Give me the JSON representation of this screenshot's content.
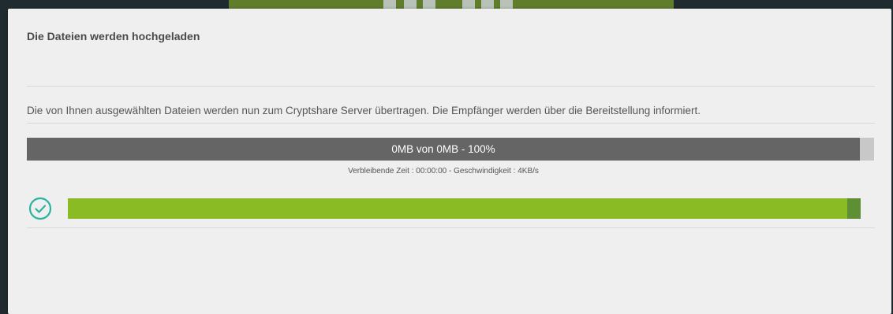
{
  "dialog": {
    "title": "Die Dateien werden hochgeladen",
    "info_text": "Die von Ihnen ausgewählten Dateien werden nun zum Cryptshare Server übertragen. Die Empfänger werden über die Bereitstellung informiert."
  },
  "total_progress": {
    "label": "0MB von  0MB - 100%",
    "percent": 100,
    "stats": "Verbleibende Zeit : 00:00:00 -  Geschwindigkeit : 4KB/s"
  },
  "file_progress": {
    "status_icon": "check-circle-icon",
    "percent": 100
  },
  "colors": {
    "progress_gray": "#666565",
    "progress_green": "#8bbb24",
    "check_teal": "#2bb3a0"
  }
}
